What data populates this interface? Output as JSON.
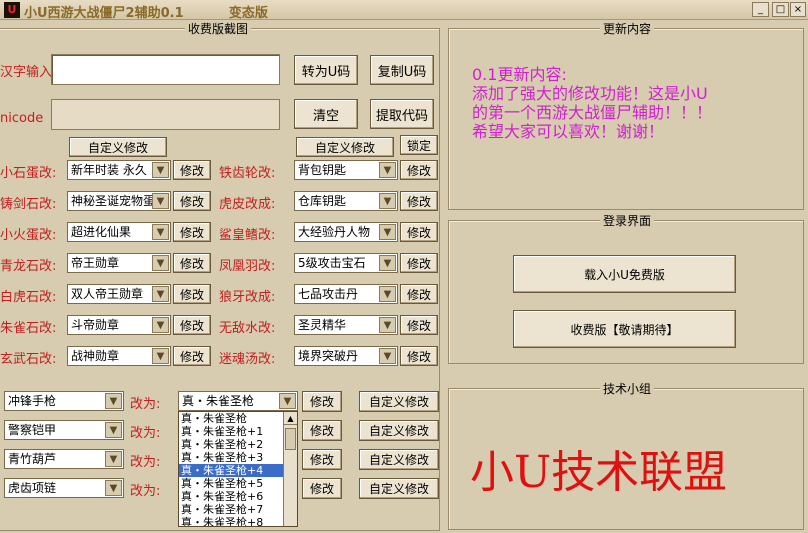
{
  "window": {
    "icon": "U",
    "title": "小U西游大战僵尸2辅助0.1          变态版"
  },
  "paid": {
    "title": "收费版截图",
    "chinese_label": "汉字输入",
    "unicode_label": "nicode",
    "btn_to_u": "转为U码",
    "btn_copy_u": "复制U码",
    "btn_clear": "清空",
    "btn_extract": "提取代码",
    "btn_custom_left": "自定义修改",
    "btn_custom_right": "自定义修改",
    "btn_lock": "锁定",
    "modify_label": "修改",
    "left_rows": [
      {
        "label": "小石蛋改:",
        "value": "新年时装 永久"
      },
      {
        "label": "铸剑石改:",
        "value": "神秘圣诞宠物蛋"
      },
      {
        "label": "小火蛋改:",
        "value": "超进化仙果"
      },
      {
        "label": "青龙石改:",
        "value": "帝王勋章"
      },
      {
        "label": "白虎石改:",
        "value": "双人帝王勋章"
      },
      {
        "label": "朱雀石改:",
        "value": "斗帝勋章"
      },
      {
        "label": "玄武石改:",
        "value": "战神勋章"
      }
    ],
    "right_rows": [
      {
        "label": "铁齿轮改:",
        "value": "背包钥匙"
      },
      {
        "label": "虎皮改成:",
        "value": "仓库钥匙"
      },
      {
        "label": "鲨皇鳍改:",
        "value": "大经验丹人物"
      },
      {
        "label": "凤凰羽改:",
        "value": "5级攻击宝石"
      },
      {
        "label": "狼牙改成:",
        "value": "七品攻击丹"
      },
      {
        "label": "无敌水改:",
        "value": "圣灵精华"
      },
      {
        "label": "迷魂汤改:",
        "value": "境界突破丹"
      }
    ],
    "change_to_label": "改为:",
    "btn_modify": "修改",
    "btn_custom": "自定义修改",
    "item_rows": [
      {
        "item": "冲锋手枪",
        "target": "真・朱雀圣枪"
      },
      {
        "item": "警察铠甲"
      },
      {
        "item": "青竹葫芦"
      },
      {
        "item": "虎齿项链"
      }
    ],
    "dropdown_options": [
      "真・朱雀圣枪",
      "真・朱雀圣枪+1",
      "真・朱雀圣枪+2",
      "真・朱雀圣枪+3",
      "真・朱雀圣枪+4",
      "真・朱雀圣枪+5",
      "真・朱雀圣枪+6",
      "真・朱雀圣枪+7",
      "真・朱雀圣枪+8"
    ],
    "dropdown_selected_index": 4
  },
  "updates": {
    "title": "更新内容",
    "text": "0.1更新内容:\n添加了强大的修改功能！这是小U\n的第一个西游大战僵尸辅助！！！\n希望大家可以喜欢！谢谢！"
  },
  "login": {
    "title": "登录界面",
    "btn_free": "载入小U免费版",
    "btn_paid": "收费版【敬请期待】"
  },
  "tech": {
    "title": "技术小组",
    "brand": "小U技术联盟"
  },
  "colors": {
    "label_red": "#c02020",
    "notes_magenta": "#d020d0",
    "brand_red": "#e01010",
    "selection_blue": "#3a6cc8"
  }
}
